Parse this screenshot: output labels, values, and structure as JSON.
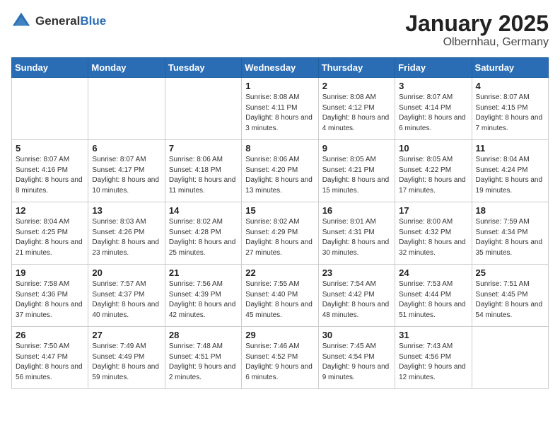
{
  "header": {
    "logo_general": "General",
    "logo_blue": "Blue",
    "month": "January 2025",
    "location": "Olbernhau, Germany"
  },
  "weekdays": [
    "Sunday",
    "Monday",
    "Tuesday",
    "Wednesday",
    "Thursday",
    "Friday",
    "Saturday"
  ],
  "weeks": [
    [
      {
        "day": "",
        "sunrise": "",
        "sunset": "",
        "daylight": ""
      },
      {
        "day": "",
        "sunrise": "",
        "sunset": "",
        "daylight": ""
      },
      {
        "day": "",
        "sunrise": "",
        "sunset": "",
        "daylight": ""
      },
      {
        "day": "1",
        "sunrise": "Sunrise: 8:08 AM",
        "sunset": "Sunset: 4:11 PM",
        "daylight": "Daylight: 8 hours and 3 minutes."
      },
      {
        "day": "2",
        "sunrise": "Sunrise: 8:08 AM",
        "sunset": "Sunset: 4:12 PM",
        "daylight": "Daylight: 8 hours and 4 minutes."
      },
      {
        "day": "3",
        "sunrise": "Sunrise: 8:07 AM",
        "sunset": "Sunset: 4:14 PM",
        "daylight": "Daylight: 8 hours and 6 minutes."
      },
      {
        "day": "4",
        "sunrise": "Sunrise: 8:07 AM",
        "sunset": "Sunset: 4:15 PM",
        "daylight": "Daylight: 8 hours and 7 minutes."
      }
    ],
    [
      {
        "day": "5",
        "sunrise": "Sunrise: 8:07 AM",
        "sunset": "Sunset: 4:16 PM",
        "daylight": "Daylight: 8 hours and 8 minutes."
      },
      {
        "day": "6",
        "sunrise": "Sunrise: 8:07 AM",
        "sunset": "Sunset: 4:17 PM",
        "daylight": "Daylight: 8 hours and 10 minutes."
      },
      {
        "day": "7",
        "sunrise": "Sunrise: 8:06 AM",
        "sunset": "Sunset: 4:18 PM",
        "daylight": "Daylight: 8 hours and 11 minutes."
      },
      {
        "day": "8",
        "sunrise": "Sunrise: 8:06 AM",
        "sunset": "Sunset: 4:20 PM",
        "daylight": "Daylight: 8 hours and 13 minutes."
      },
      {
        "day": "9",
        "sunrise": "Sunrise: 8:05 AM",
        "sunset": "Sunset: 4:21 PM",
        "daylight": "Daylight: 8 hours and 15 minutes."
      },
      {
        "day": "10",
        "sunrise": "Sunrise: 8:05 AM",
        "sunset": "Sunset: 4:22 PM",
        "daylight": "Daylight: 8 hours and 17 minutes."
      },
      {
        "day": "11",
        "sunrise": "Sunrise: 8:04 AM",
        "sunset": "Sunset: 4:24 PM",
        "daylight": "Daylight: 8 hours and 19 minutes."
      }
    ],
    [
      {
        "day": "12",
        "sunrise": "Sunrise: 8:04 AM",
        "sunset": "Sunset: 4:25 PM",
        "daylight": "Daylight: 8 hours and 21 minutes."
      },
      {
        "day": "13",
        "sunrise": "Sunrise: 8:03 AM",
        "sunset": "Sunset: 4:26 PM",
        "daylight": "Daylight: 8 hours and 23 minutes."
      },
      {
        "day": "14",
        "sunrise": "Sunrise: 8:02 AM",
        "sunset": "Sunset: 4:28 PM",
        "daylight": "Daylight: 8 hours and 25 minutes."
      },
      {
        "day": "15",
        "sunrise": "Sunrise: 8:02 AM",
        "sunset": "Sunset: 4:29 PM",
        "daylight": "Daylight: 8 hours and 27 minutes."
      },
      {
        "day": "16",
        "sunrise": "Sunrise: 8:01 AM",
        "sunset": "Sunset: 4:31 PM",
        "daylight": "Daylight: 8 hours and 30 minutes."
      },
      {
        "day": "17",
        "sunrise": "Sunrise: 8:00 AM",
        "sunset": "Sunset: 4:32 PM",
        "daylight": "Daylight: 8 hours and 32 minutes."
      },
      {
        "day": "18",
        "sunrise": "Sunrise: 7:59 AM",
        "sunset": "Sunset: 4:34 PM",
        "daylight": "Daylight: 8 hours and 35 minutes."
      }
    ],
    [
      {
        "day": "19",
        "sunrise": "Sunrise: 7:58 AM",
        "sunset": "Sunset: 4:36 PM",
        "daylight": "Daylight: 8 hours and 37 minutes."
      },
      {
        "day": "20",
        "sunrise": "Sunrise: 7:57 AM",
        "sunset": "Sunset: 4:37 PM",
        "daylight": "Daylight: 8 hours and 40 minutes."
      },
      {
        "day": "21",
        "sunrise": "Sunrise: 7:56 AM",
        "sunset": "Sunset: 4:39 PM",
        "daylight": "Daylight: 8 hours and 42 minutes."
      },
      {
        "day": "22",
        "sunrise": "Sunrise: 7:55 AM",
        "sunset": "Sunset: 4:40 PM",
        "daylight": "Daylight: 8 hours and 45 minutes."
      },
      {
        "day": "23",
        "sunrise": "Sunrise: 7:54 AM",
        "sunset": "Sunset: 4:42 PM",
        "daylight": "Daylight: 8 hours and 48 minutes."
      },
      {
        "day": "24",
        "sunrise": "Sunrise: 7:53 AM",
        "sunset": "Sunset: 4:44 PM",
        "daylight": "Daylight: 8 hours and 51 minutes."
      },
      {
        "day": "25",
        "sunrise": "Sunrise: 7:51 AM",
        "sunset": "Sunset: 4:45 PM",
        "daylight": "Daylight: 8 hours and 54 minutes."
      }
    ],
    [
      {
        "day": "26",
        "sunrise": "Sunrise: 7:50 AM",
        "sunset": "Sunset: 4:47 PM",
        "daylight": "Daylight: 8 hours and 56 minutes."
      },
      {
        "day": "27",
        "sunrise": "Sunrise: 7:49 AM",
        "sunset": "Sunset: 4:49 PM",
        "daylight": "Daylight: 8 hours and 59 minutes."
      },
      {
        "day": "28",
        "sunrise": "Sunrise: 7:48 AM",
        "sunset": "Sunset: 4:51 PM",
        "daylight": "Daylight: 9 hours and 2 minutes."
      },
      {
        "day": "29",
        "sunrise": "Sunrise: 7:46 AM",
        "sunset": "Sunset: 4:52 PM",
        "daylight": "Daylight: 9 hours and 6 minutes."
      },
      {
        "day": "30",
        "sunrise": "Sunrise: 7:45 AM",
        "sunset": "Sunset: 4:54 PM",
        "daylight": "Daylight: 9 hours and 9 minutes."
      },
      {
        "day": "31",
        "sunrise": "Sunrise: 7:43 AM",
        "sunset": "Sunset: 4:56 PM",
        "daylight": "Daylight: 9 hours and 12 minutes."
      },
      {
        "day": "",
        "sunrise": "",
        "sunset": "",
        "daylight": ""
      }
    ]
  ]
}
